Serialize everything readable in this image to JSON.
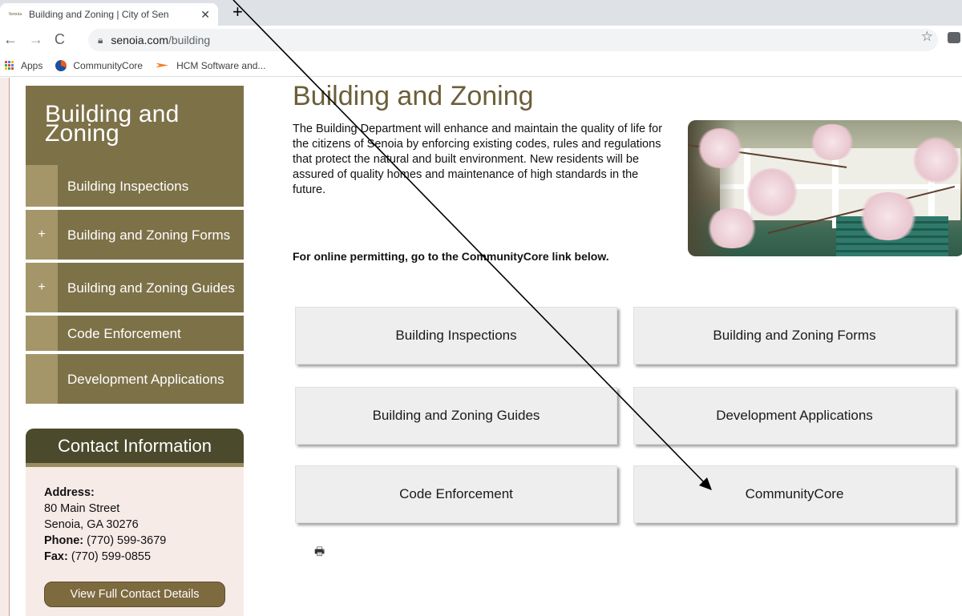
{
  "browser": {
    "tab_title": "Building and Zoning | City of Sen",
    "tab_close": "✕",
    "new_tab": "+",
    "url_domain": "senoia.com",
    "url_path": "/building",
    "bookmarks": [
      {
        "label": "Apps"
      },
      {
        "label": "CommunityCore"
      },
      {
        "label": "HCM Software and..."
      }
    ],
    "favicon_text": "Senoia"
  },
  "sidebar": {
    "title": "Building and Zoning",
    "items": [
      {
        "mark": "",
        "label": "Building Inspections"
      },
      {
        "mark": "+",
        "label": "Building and Zoning Forms"
      },
      {
        "mark": "+",
        "label": "Building and Zoning Guides"
      },
      {
        "mark": "",
        "label": "Code Enforcement"
      },
      {
        "mark": "",
        "label": "Development Applications"
      }
    ]
  },
  "contact": {
    "title": "Contact Information",
    "address_label": "Address:",
    "address_line1": "80 Main Street",
    "address_line2": "Senoia, GA 30276",
    "phone_label": "Phone:",
    "phone": "(770) 599-3679",
    "fax_label": "Fax:",
    "fax": "(770) 599-0855",
    "button": "View Full Contact Details"
  },
  "main": {
    "title": "Building and Zoning",
    "intro": "The Building Department will enhance and maintain the quality of life for the citizens of Senoia by enforcing existing codes, rules and regulations that protect the natural and built environment. New residents will be assured of quality homes and maintenance of high standards in the future.",
    "online_note": "For online permitting, go to the CommunityCore link below.",
    "tiles": [
      "Building Inspections",
      "Building and Zoning Forms",
      "Building and Zoning Guides",
      "Development Applications",
      "Code Enforcement",
      "CommunityCore"
    ]
  },
  "colors": {
    "sidebar": "#7d7148",
    "sidebar_mark": "#a49669",
    "contact_head": "#4b4a2c",
    "title": "#6b5f3a",
    "tile": "#eeeeee"
  }
}
